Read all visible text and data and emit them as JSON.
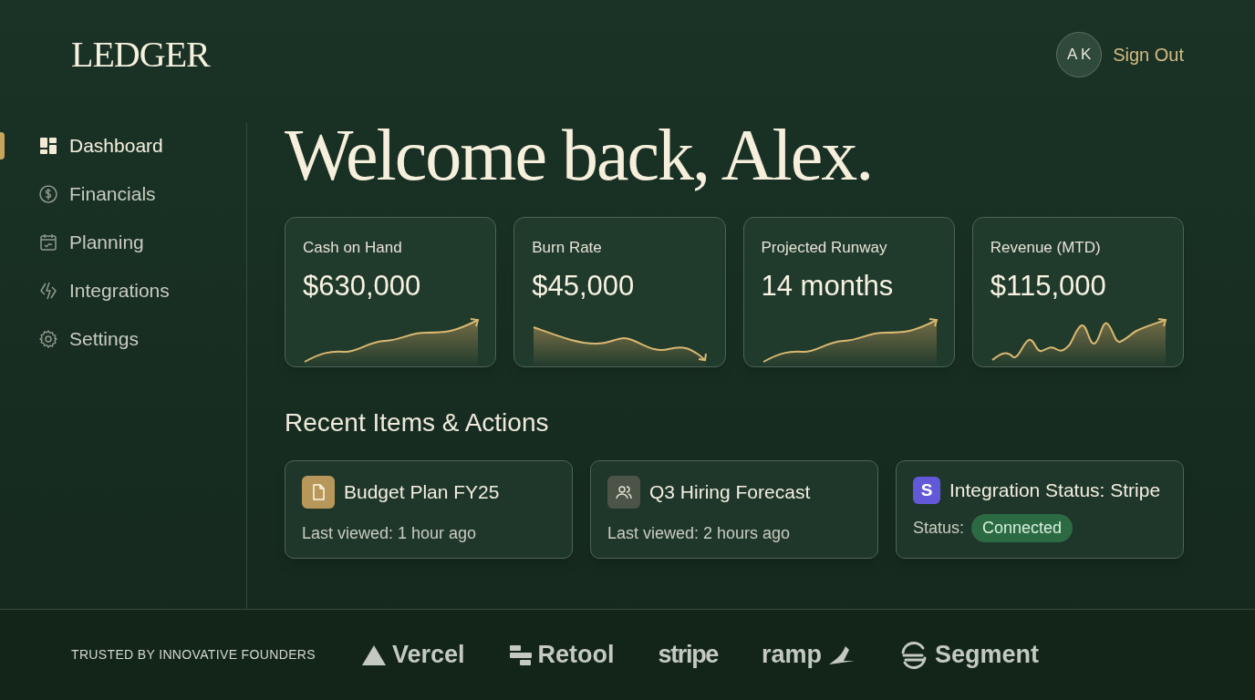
{
  "brand": "LEDGER",
  "user": {
    "initials": "A K",
    "sign_out": "Sign Out"
  },
  "sidebar": {
    "items": [
      {
        "label": "Dashboard",
        "kind": "grid",
        "selected": true
      },
      {
        "label": "Financials",
        "kind": "dollar",
        "selected": false
      },
      {
        "label": "Planning",
        "kind": "calendar",
        "selected": false
      },
      {
        "label": "Integrations",
        "kind": "spark",
        "selected": false
      },
      {
        "label": "Settings",
        "kind": "gear",
        "selected": false
      }
    ]
  },
  "heading": "Welcome back, Alex.",
  "metrics": [
    {
      "label": "Cash on Hand",
      "value": "$630,000",
      "kind": "rising"
    },
    {
      "label": "Burn Rate",
      "value": "$45,000",
      "kind": "falling"
    },
    {
      "label": "Projected Runway",
      "value": "14 months",
      "kind": "rising"
    },
    {
      "label": "Revenue (MTD)",
      "value": "$115,000",
      "kind": "volatile"
    }
  ],
  "recent": {
    "title": "Recent Items & Actions",
    "items": [
      {
        "kind": "document",
        "title": "Budget Plan FY25",
        "detail": "Last viewed: 1 hour ago"
      },
      {
        "kind": "people",
        "title": "Q3 Hiring Forecast",
        "detail": "Last viewed: 2 hours ago"
      },
      {
        "kind": "integration",
        "icon_letter": "S",
        "title": "Integration Status: Stripe",
        "detail": "Status:",
        "badge": "Connected"
      }
    ]
  },
  "footer": {
    "caption": "TRUSTED BY INNOVATIVE FOUNDERS",
    "logos": [
      {
        "kind": "triangle",
        "name": "Vercel"
      },
      {
        "kind": "bars",
        "name": "Retool"
      },
      {
        "kind": "plain",
        "name": "stripe"
      },
      {
        "kind": "ramp",
        "name": "ramp"
      },
      {
        "kind": "segment",
        "name": "Segment"
      }
    ]
  }
}
